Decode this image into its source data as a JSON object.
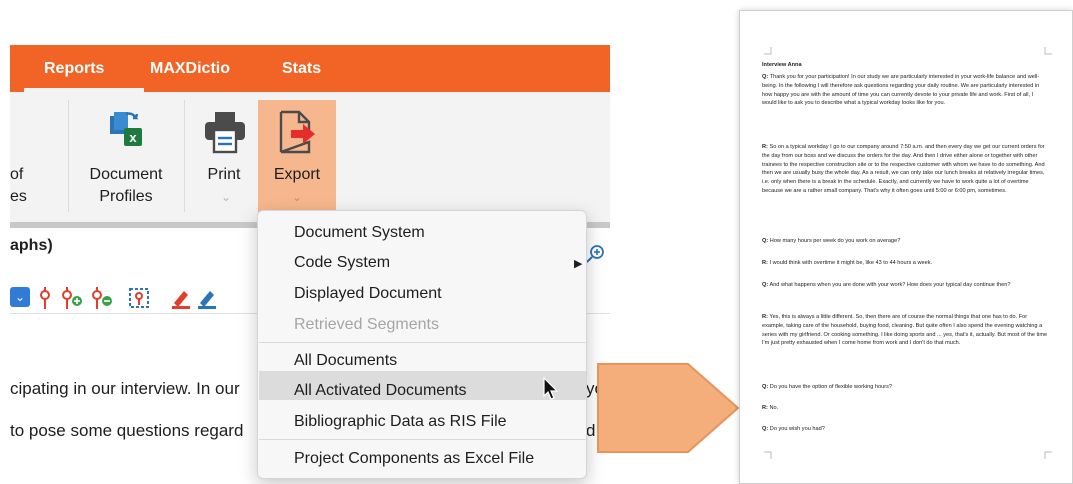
{
  "ribbon": {
    "tabs": [
      "Reports",
      "MAXDictio",
      "Stats"
    ],
    "partial_label": [
      "of",
      "es"
    ],
    "document_profiles": [
      "Document",
      "Profiles"
    ],
    "print_label": "Print",
    "export_label": "Export"
  },
  "heading_partial": "aphs)",
  "doc_text": [
    "cipating in our interview. In our",
    "to pose some questions regard",
    "yo",
    "d y"
  ],
  "menu": {
    "items": [
      {
        "label": "Document System",
        "enabled": true
      },
      {
        "label": "Code System",
        "enabled": true,
        "submenu": true
      },
      {
        "label": "Displayed Document",
        "enabled": true
      },
      {
        "label": "Retrieved Segments",
        "enabled": false
      },
      {
        "label": "All Documents",
        "enabled": true
      },
      {
        "label": "All Activated Documents",
        "enabled": true,
        "highlighted": true
      },
      {
        "label": "Bibliographic Data as RIS File",
        "enabled": true
      },
      {
        "label": "Project Components as Excel File",
        "enabled": true
      }
    ]
  },
  "exported_page": {
    "title": "Interview Anna",
    "paragraphs": [
      {
        "speaker": "Q:",
        "text": "Thank you for your participation! In our study we are particularly interested in your work-life balance and well-being. In the following I will therefore ask questions regarding your daily routine. We are particularly interested in how happy you are with the amount of time you can currently devote to your private life and work. First of all, I would like to ask you to describe what a typical workday looks like for you."
      },
      {
        "speaker": "R:",
        "text": "So on a typical workday I go to our company around 7:50 a.m. and then every day we get our current orders for the day from our boss and we discuss the orders for the day. And then I drive either alone or together with other trainees to the respective construction site or to the respective customer with whom we have to do something. And then we are usually busy the whole day. As a result, we can only take our lunch breaks at relatively irregular times, i.e. only when there is a break in the schedule. Exactly, and currently we have to work quite a lot of overtime because we are a rather small company. That's why it often goes until 5:00 or 6:00 pm, sometimes."
      },
      {
        "speaker": "Q:",
        "text": "How many hours per week do you work on average?"
      },
      {
        "speaker": "R:",
        "text": "I would think with overtime it might be, like 43 to 44 hours a week."
      },
      {
        "speaker": "Q:",
        "text": "And what happens when you are done with your work? How does your typical day continue then?"
      },
      {
        "speaker": "R:",
        "text": "Yes, this is always a little different. So, then there are of course the normal things that one has to do. For example, taking care of the household, buying food, cleaning. But quite often I also spend the evening watching a series with my girlfriend. Or cooking something. I like doing sports and ... yes, that's it, actually. But most of the time I'm just pretty exhausted when I come home from work and I don't do that much."
      },
      {
        "speaker": "Q:",
        "text": "Do you have the option of flexible working hours?"
      },
      {
        "speaker": "R:",
        "text": "No."
      },
      {
        "speaker": "Q:",
        "text": "Do you wish you had?"
      }
    ]
  },
  "colors": {
    "ribbon_orange": "#f26425",
    "export_highlight": "#f6b78e",
    "arrow_fill": "#f3ae7c",
    "arrow_stroke": "#e8935a"
  }
}
